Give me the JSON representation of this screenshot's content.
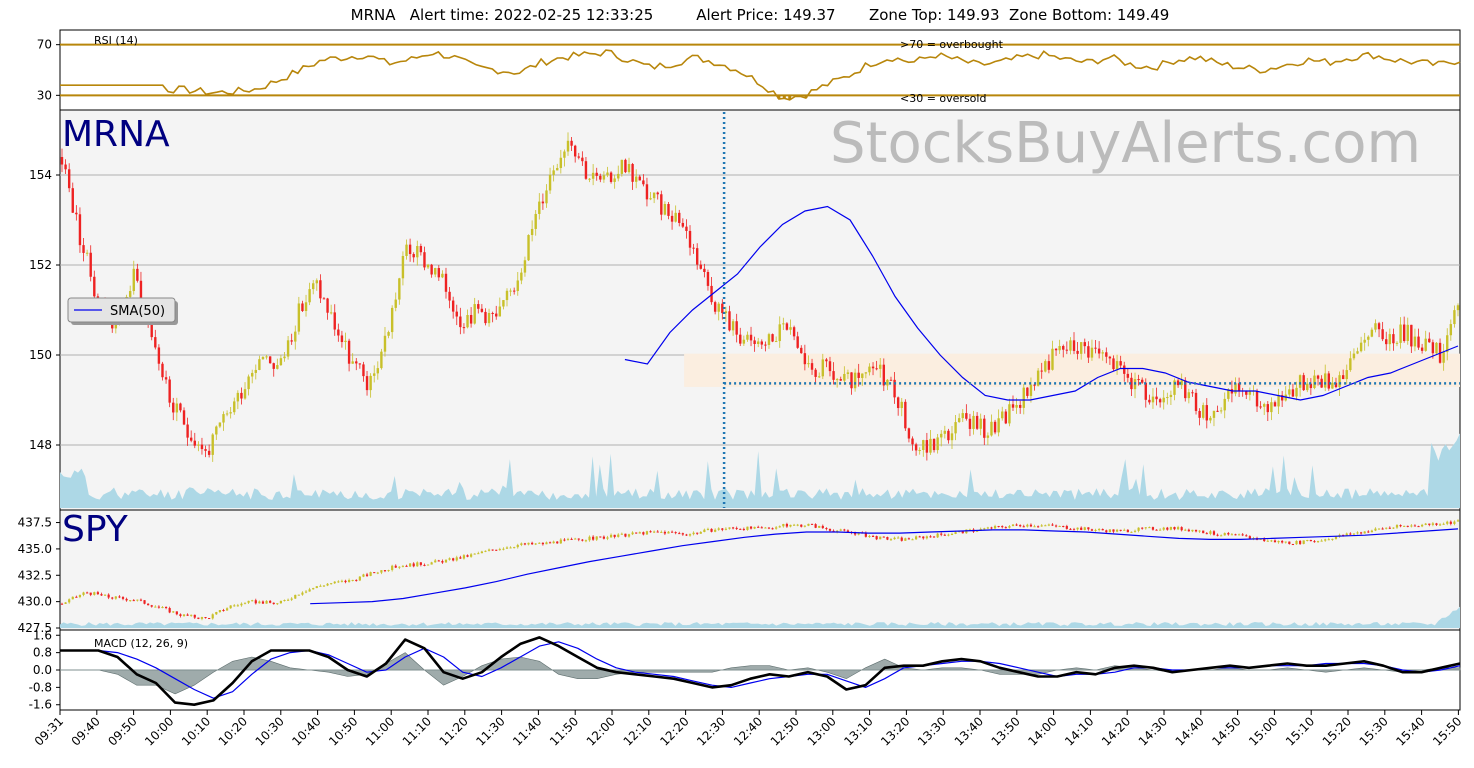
{
  "header": {
    "title": "MRNA   Alert time: 2022-02-25 12:33:25         Alert Price: 149.37       Zone Top: 149.93  Zone Bottom: 149.49"
  },
  "rsi_panel": {
    "label": "RSI (14)",
    "overbought_text": ">70 = overbought",
    "oversold_text": "<30 = oversold"
  },
  "price_panel": {
    "ticker_label": "MRNA",
    "watermark": "StocksBuyAlerts.com",
    "legend_label": "SMA(50)"
  },
  "spy_panel": {
    "ticker_label": "SPY"
  },
  "macd_panel": {
    "label": "MACD (12, 26, 9)"
  },
  "colors": {
    "up_candle": "#c8c02a",
    "down_candle": "#ee2222",
    "sma": "#0000ee",
    "rsi": "#b8860b",
    "volume": "#add8e6",
    "zone": "#fbeee0",
    "alert_line": "#1f77b4",
    "macd_line": "#000000",
    "signal_line": "#0000ee",
    "histogram": "#7f8f8f",
    "watermark": "#bbbbbb",
    "ticker_label": "#000080"
  },
  "chart_data": [
    {
      "type": "line",
      "title": "RSI (14)",
      "ylim": [
        20,
        80
      ],
      "yticks": [
        30,
        70
      ],
      "thresholds": [
        70,
        30
      ],
      "series": [
        {
          "name": "RSI (14)",
          "values": [
            38,
            38,
            37,
            36,
            33,
            35,
            34,
            32,
            33,
            35,
            42,
            50,
            58,
            60,
            62,
            55,
            58,
            64,
            60,
            52,
            50,
            48,
            56,
            60,
            62,
            64,
            58,
            52,
            55,
            60,
            56,
            50,
            40,
            28,
            30,
            38,
            45,
            55,
            60,
            56,
            62,
            58,
            54,
            56,
            60,
            62,
            58,
            56,
            60,
            54,
            52,
            58,
            60,
            55,
            52,
            50,
            54,
            58,
            56,
            60,
            62,
            58,
            56,
            54,
            58
          ]
        }
      ]
    },
    {
      "type": "candlestick",
      "title": "MRNA",
      "ylim": [
        146.6,
        155.4
      ],
      "yticks": [
        148,
        150,
        152,
        154
      ],
      "x": [
        "09:31",
        "09:35",
        "09:40",
        "09:45",
        "09:50",
        "09:55",
        "10:00",
        "10:05",
        "10:10",
        "10:15",
        "10:20",
        "10:25",
        "10:30",
        "10:35",
        "10:40",
        "10:45",
        "10:50",
        "10:55",
        "11:00",
        "11:05",
        "11:10",
        "11:15",
        "11:20",
        "11:25",
        "11:30",
        "11:35",
        "11:40",
        "11:45",
        "11:50",
        "11:55",
        "12:00",
        "12:05",
        "12:10",
        "12:15",
        "12:20",
        "12:25",
        "12:30",
        "12:35",
        "12:40",
        "12:45",
        "12:50",
        "12:55",
        "13:00",
        "13:05",
        "13:10",
        "13:15",
        "13:20",
        "13:25",
        "13:30",
        "13:35",
        "13:40",
        "13:45",
        "13:50",
        "13:55",
        "14:00",
        "14:05",
        "14:10",
        "14:15",
        "14:20",
        "14:25",
        "14:30",
        "14:35",
        "14:40",
        "14:45",
        "14:50",
        "14:55",
        "15:00",
        "15:05",
        "15:10",
        "15:15",
        "15:20",
        "15:25",
        "15:30",
        "15:35",
        "15:40",
        "15:45",
        "15:50",
        "15:55"
      ],
      "close": [
        154.4,
        152.6,
        151.2,
        150.6,
        151.8,
        150.4,
        148.9,
        148.3,
        147.8,
        148.6,
        149.3,
        150.1,
        149.7,
        150.9,
        151.6,
        150.7,
        149.8,
        149.3,
        150.6,
        152.4,
        152.1,
        151.6,
        150.8,
        151.0,
        150.8,
        151.6,
        152.9,
        154.1,
        154.9,
        154.0,
        153.8,
        154.3,
        153.7,
        153.3,
        153.1,
        152.2,
        151.2,
        150.6,
        150.2,
        150.3,
        150.7,
        149.6,
        149.7,
        149.4,
        149.4,
        149.7,
        149.2,
        147.9,
        148.0,
        148.3,
        148.6,
        148.3,
        148.6,
        149.1,
        149.7,
        150.1,
        150.2,
        150.1,
        149.8,
        149.4,
        149.0,
        149.3,
        149.2,
        148.7,
        148.9,
        149.3,
        148.9,
        149.0,
        149.3,
        149.5,
        149.4,
        149.7,
        150.6,
        150.4,
        150.5,
        150.3,
        150.0,
        151.2
      ],
      "sma50": [
        null,
        null,
        null,
        null,
        null,
        null,
        null,
        null,
        null,
        null,
        null,
        null,
        null,
        null,
        null,
        null,
        null,
        null,
        null,
        null,
        null,
        null,
        null,
        null,
        null,
        149.9,
        149.8,
        150.5,
        151.0,
        151.4,
        151.8,
        152.4,
        152.9,
        153.2,
        153.3,
        153.0,
        152.2,
        151.3,
        150.6,
        150.0,
        149.5,
        149.1,
        149.0,
        149.0,
        149.1,
        149.2,
        149.5,
        149.7,
        149.7,
        149.6,
        149.4,
        149.3,
        149.2,
        149.2,
        149.1,
        149.0,
        149.1,
        149.3,
        149.5,
        149.6,
        149.8,
        150.0,
        150.2
      ]
    },
    {
      "type": "candlestick",
      "title": "SPY",
      "ylim": [
        427.5,
        438.5
      ],
      "yticks": [
        427.5,
        430.0,
        432.5,
        435.0,
        437.5
      ],
      "close": [
        429.8,
        430.9,
        430.4,
        430.2,
        429.5,
        428.7,
        428.4,
        429.6,
        430.0,
        429.8,
        431.0,
        431.7,
        432.0,
        432.8,
        433.4,
        433.6,
        433.9,
        434.4,
        435.0,
        435.4,
        435.5,
        435.8,
        436.0,
        436.2,
        436.5,
        436.6,
        436.4,
        436.8,
        437.0,
        436.9,
        437.2,
        437.3,
        436.8,
        436.5,
        436.0,
        435.9,
        436.2,
        436.5,
        436.8,
        437.1,
        437.3,
        437.2,
        437.0,
        436.8,
        436.7,
        436.9,
        437.0,
        436.8,
        436.4,
        436.2,
        435.8,
        435.6,
        435.7,
        436.2,
        436.6,
        437.0,
        437.2,
        437.4,
        437.6
      ],
      "sma50": [
        null,
        null,
        null,
        null,
        null,
        null,
        null,
        null,
        429.8,
        429.9,
        430.0,
        430.3,
        430.8,
        431.3,
        431.9,
        432.6,
        433.2,
        433.8,
        434.3,
        434.8,
        435.3,
        435.7,
        436.1,
        436.4,
        436.6,
        436.6,
        436.5,
        436.5,
        436.6,
        436.7,
        436.8,
        436.8,
        436.7,
        436.6,
        436.4,
        436.2,
        436.0,
        435.9,
        435.9,
        436.0,
        436.1,
        436.2,
        436.3,
        436.5,
        436.7,
        436.9
      ]
    },
    {
      "type": "line",
      "title": "MACD (12, 26, 9)",
      "ylim": [
        -1.75,
        1.75
      ],
      "yticks": [
        -1.6,
        -0.8,
        0.0,
        0.8,
        1.6
      ],
      "series": [
        {
          "name": "MACD",
          "values": [
            0.9,
            0.9,
            0.9,
            0.6,
            -0.2,
            -0.6,
            -1.5,
            -1.6,
            -1.4,
            -0.6,
            0.4,
            0.9,
            0.9,
            0.9,
            0.6,
            0.0,
            -0.3,
            0.3,
            1.4,
            1.0,
            -0.1,
            -0.4,
            -0.1,
            0.6,
            1.2,
            1.5,
            1.1,
            0.6,
            0.1,
            -0.1,
            -0.2,
            -0.3,
            -0.4,
            -0.6,
            -0.8,
            -0.7,
            -0.4,
            -0.2,
            -0.3,
            -0.1,
            -0.3,
            -0.9,
            -0.7,
            0.1,
            0.2,
            0.2,
            0.4,
            0.5,
            0.4,
            0.1,
            -0.1,
            -0.3,
            -0.3,
            -0.1,
            -0.2,
            0.1,
            0.2,
            0.1,
            -0.1,
            0.0,
            0.1,
            0.2,
            0.1,
            0.2,
            0.3,
            0.2,
            0.2,
            0.3,
            0.4,
            0.2,
            -0.1,
            -0.1,
            0.1,
            0.3
          ]
        },
        {
          "name": "Signal",
          "values": [
            0.9,
            0.9,
            0.9,
            0.8,
            0.5,
            0.1,
            -0.4,
            -0.9,
            -1.3,
            -1.0,
            -0.2,
            0.5,
            0.8,
            0.9,
            0.7,
            0.3,
            -0.1,
            0.0,
            0.6,
            1.0,
            0.6,
            -0.1,
            -0.3,
            0.1,
            0.6,
            1.1,
            1.3,
            1.0,
            0.5,
            0.1,
            -0.1,
            -0.2,
            -0.3,
            -0.5,
            -0.7,
            -0.8,
            -0.6,
            -0.4,
            -0.3,
            -0.2,
            -0.2,
            -0.5,
            -0.8,
            -0.4,
            0.1,
            0.2,
            0.3,
            0.4,
            0.4,
            0.3,
            0.1,
            -0.1,
            -0.3,
            -0.2,
            -0.2,
            -0.1,
            0.1,
            0.1,
            0.0,
            0.0,
            0.1,
            0.1,
            0.1,
            0.2,
            0.2,
            0.2,
            0.3,
            0.3,
            0.3,
            0.2,
            0.0,
            -0.1,
            0.0,
            0.2
          ]
        }
      ]
    }
  ],
  "x_axis": {
    "ticks": [
      "09:31",
      "09:40",
      "09:50",
      "10:00",
      "10:10",
      "10:20",
      "10:30",
      "10:40",
      "10:50",
      "11:00",
      "11:10",
      "11:20",
      "11:30",
      "11:40",
      "11:50",
      "12:00",
      "12:10",
      "12:20",
      "12:30",
      "12:40",
      "12:50",
      "13:00",
      "13:10",
      "13:20",
      "13:30",
      "13:40",
      "13:50",
      "14:00",
      "14:10",
      "14:20",
      "14:30",
      "14:40",
      "14:50",
      "15:00",
      "15:10",
      "15:20",
      "15:30",
      "15:40",
      "15:50"
    ]
  },
  "alert": {
    "time": "12:33",
    "price": 149.37,
    "zone_top": 149.93,
    "zone_bottom": 149.49
  }
}
